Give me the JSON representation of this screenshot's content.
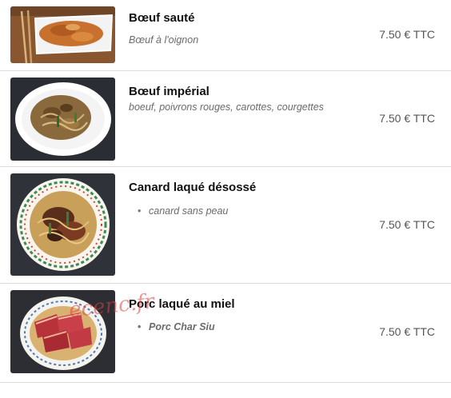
{
  "items": [
    {
      "name": "Bœuf sauté",
      "description": "Bœuf à l'oignon",
      "price": "7.50 € TTC",
      "image_icon": "beef-saute-photo"
    },
    {
      "name": "Bœuf impérial",
      "description": "boeuf, poivrons rouges, carottes, courgettes",
      "price": "7.50 € TTC",
      "image_icon": "beef-imperial-photo"
    },
    {
      "name": "Canard laqué désossé",
      "description": "canard sans peau",
      "price": "7.50 € TTC",
      "image_icon": "lacquered-duck-photo"
    },
    {
      "name": "Porc laqué au miel",
      "description": "Porc Char Siu",
      "price": "7.50 € TTC",
      "image_icon": "honey-pork-photo"
    }
  ],
  "watermark": "ecenc.fr"
}
